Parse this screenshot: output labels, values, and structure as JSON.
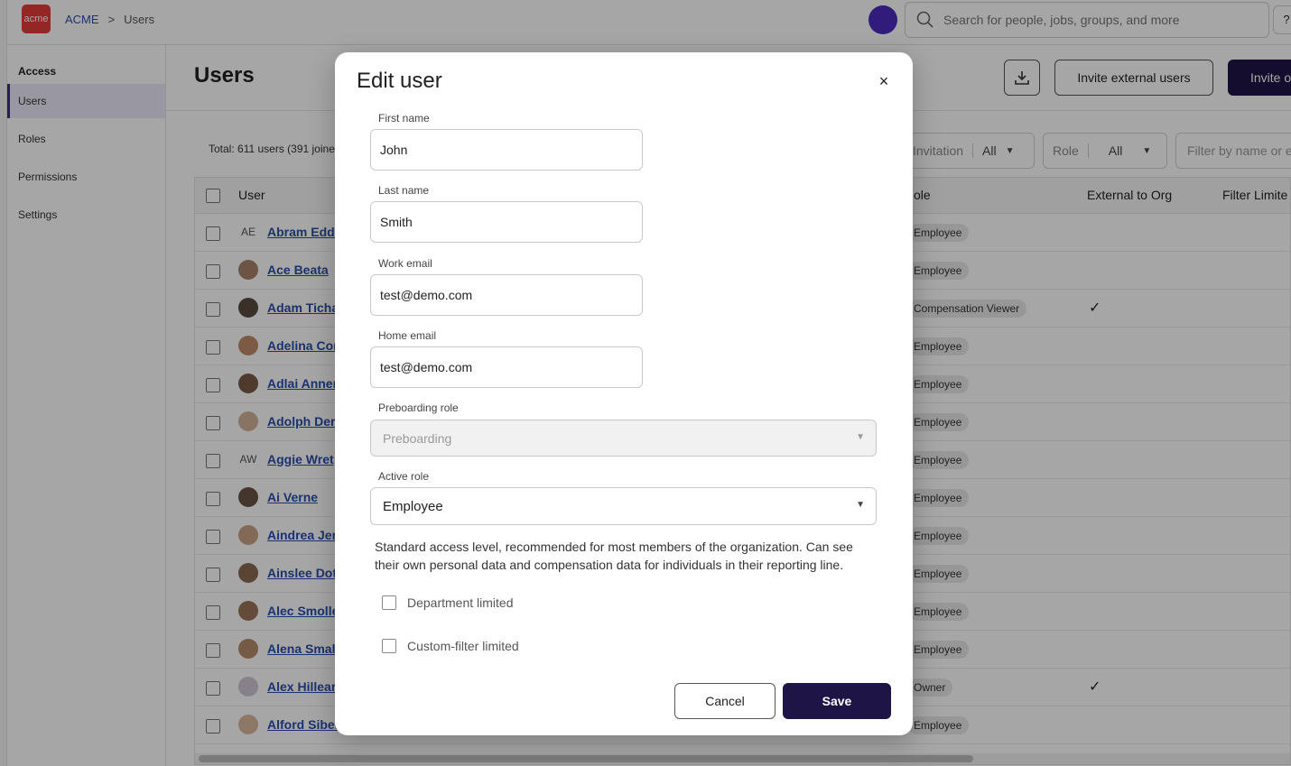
{
  "topbar": {
    "logo_text": "acme",
    "breadcrumb": [
      "ACME",
      ">",
      "Users"
    ],
    "search_placeholder": "Search for people, jobs, groups, and more",
    "help_label": "?"
  },
  "sidebar": {
    "section": "Access",
    "items": [
      "Users",
      "Roles",
      "Permissions",
      "Settings"
    ],
    "active": "Users"
  },
  "header": {
    "title": "Users",
    "invite_external_label": "Invite external users",
    "invite_label": "Invite o"
  },
  "summary": {
    "total": "Total: 611 users (391 joine"
  },
  "filters": {
    "invitation_label": "Invitation",
    "invitation_value": "All",
    "role_label": "Role",
    "role_value": "All",
    "name_placeholder": "Filter by name or e"
  },
  "table": {
    "columns": {
      "user": "User",
      "role": "ole",
      "external": "External to Org",
      "filter_limited": "Filter Limite"
    },
    "rows": [
      {
        "name": "Abram Eddi",
        "initials": "AE",
        "role": "Employee",
        "external": ""
      },
      {
        "name": "Ace Beata",
        "initials": "",
        "role": "Employee",
        "external": ""
      },
      {
        "name": "Adam Ticha",
        "initials": "",
        "role": "Compensation Viewer",
        "external": "✓"
      },
      {
        "name": "Adelina Cor",
        "initials": "",
        "role": "Employee",
        "external": ""
      },
      {
        "name": "Adlai Anner",
        "initials": "",
        "role": "Employee",
        "external": ""
      },
      {
        "name": "Adolph Der",
        "initials": "",
        "role": "Employee",
        "external": ""
      },
      {
        "name": "Aggie Wret",
        "initials": "AW",
        "role": "Employee",
        "external": ""
      },
      {
        "name": "Ai Verne",
        "initials": "",
        "role": "Employee",
        "external": ""
      },
      {
        "name": "Aindrea Jer",
        "initials": "",
        "role": "Employee",
        "external": ""
      },
      {
        "name": "Ainslee Dot",
        "initials": "",
        "role": "Employee",
        "external": ""
      },
      {
        "name": "Alec Smolle",
        "initials": "",
        "role": "Employee",
        "external": ""
      },
      {
        "name": "Alena Small",
        "initials": "",
        "role": "Employee",
        "external": ""
      },
      {
        "name": "Alex Hillear",
        "initials": "",
        "role": "Owner",
        "external": "✓"
      },
      {
        "name": "Alford Sibel",
        "initials": "",
        "role": "Employee",
        "external": ""
      }
    ]
  },
  "modal": {
    "title": "Edit user",
    "close_icon": "×",
    "first_name_label": "First name",
    "first_name": "John",
    "last_name_label": "Last name",
    "last_name": "Smith",
    "work_email_label": "Work email",
    "work_email": "test@demo.com",
    "home_email_label": "Home email",
    "home_email": "test@demo.com",
    "preboarding_role_label": "Preboarding role",
    "preboarding_role": "Preboarding",
    "active_role_label": "Active role",
    "active_role": "Employee",
    "description": "Standard access level, recommended for most members of the organization. Can see their own personal data and compensation data for individuals in their reporting line.",
    "department_limited": "Department limited",
    "custom_filter_limited": "Custom-filter limited",
    "cancel_label": "Cancel",
    "save_label": "Save"
  },
  "colors": {
    "primary": "#1f1446",
    "link": "#2a4ea8",
    "logo": "#e33b3b"
  }
}
